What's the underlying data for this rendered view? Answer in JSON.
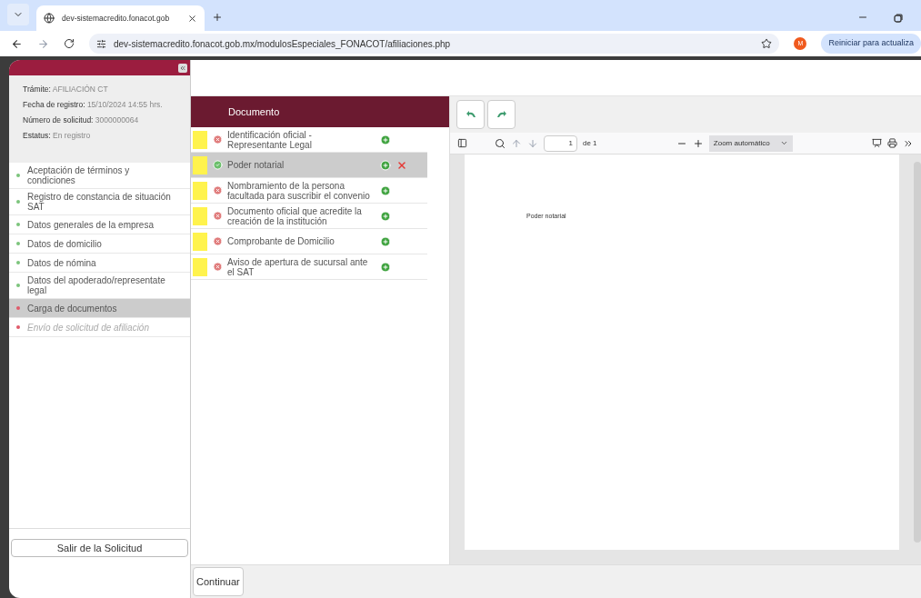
{
  "browser": {
    "tab": {
      "title": "dev-sistemacredito.fonacot.gob",
      "selected": true
    },
    "url": "dev-sistemacredito.fonacot.gob.mx/modulosEspeciales_FONACOT/afiliaciones.php",
    "avatar": "M",
    "update_button": "Reiniciar para actualiza"
  },
  "sidebar": {
    "info": [
      {
        "label": "Trámite:",
        "value": "AFILIACIÓN CT"
      },
      {
        "label": "Fecha de registro:",
        "value": "15/10/2024 14:55 hrs."
      },
      {
        "label": "Número de solicitud:",
        "value": "3000000064"
      },
      {
        "label": "Estatus:",
        "value": "En registro"
      }
    ],
    "steps": [
      {
        "label": "Aceptación de términos y condiciones",
        "color": "#7cc47c",
        "selected": false,
        "disabled": false
      },
      {
        "label": "Registro de constancia de situación SAT",
        "color": "#7cc47c",
        "selected": false,
        "disabled": false
      },
      {
        "label": "Datos generales de la empresa",
        "color": "#7cc47c",
        "selected": false,
        "disabled": false
      },
      {
        "label": "Datos de domicilio",
        "color": "#7cc47c",
        "selected": false,
        "disabled": false
      },
      {
        "label": "Datos de nómina",
        "color": "#7cc47c",
        "selected": false,
        "disabled": false
      },
      {
        "label": "Datos del apoderado/representate legal",
        "color": "#7cc47c",
        "selected": false,
        "disabled": false
      },
      {
        "label": "Carga de documentos",
        "color": "#e05a6a",
        "selected": true,
        "disabled": false
      },
      {
        "label": "Envío de solicitud de afiliación",
        "color": "#e05a6a",
        "selected": false,
        "disabled": true
      }
    ],
    "exit_button": "Salir de la Solicitud"
  },
  "documents": {
    "header": "Documento",
    "rows": [
      {
        "name": "Identificación oficial - Representante Legal",
        "uploaded": false,
        "selected": false
      },
      {
        "name": "Poder notarial",
        "uploaded": true,
        "selected": true
      },
      {
        "name": "Nombramiento de la persona facultada para suscribir el convenio",
        "uploaded": false,
        "selected": false
      },
      {
        "name": "Documento oficial que acredite la creación de la institución",
        "uploaded": false,
        "selected": false
      },
      {
        "name": "Comprobante de Domicilio",
        "uploaded": false,
        "selected": false
      },
      {
        "name": "Aviso de apertura de sucursal ante el SAT",
        "uploaded": false,
        "selected": false
      }
    ]
  },
  "viewer": {
    "page": "1",
    "page_count": "de 1",
    "zoom": "Zoom automático",
    "page_text": "Poder notarial"
  },
  "continue_button": "Continuar"
}
